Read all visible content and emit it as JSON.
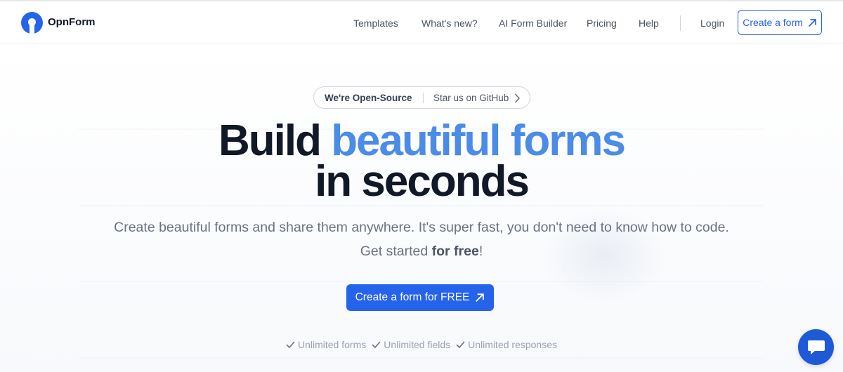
{
  "brand": {
    "name": "OpnForm",
    "logo_icon": "opnform-logo-icon",
    "color": "#2563eb"
  },
  "nav": {
    "links": [
      {
        "label": "Templates"
      },
      {
        "label": "What's new?"
      },
      {
        "label": "AI Form Builder"
      },
      {
        "label": "Pricing"
      },
      {
        "label": "Help"
      },
      {
        "label": "Login"
      }
    ],
    "cta_label": "Create a form",
    "cta_icon": "arrow-up-right-icon"
  },
  "badge": {
    "left_label": "We're Open-Source",
    "right_label": "Star us on GitHub",
    "icon": "chevron-right-icon"
  },
  "hero": {
    "headline_part1": "Build ",
    "headline_accent": "beautiful forms",
    "headline_line2": "in seconds",
    "accent_color": "#4a8ce6",
    "subtext": "Create beautiful forms and share them anywhere. It's super fast, you don't need to know how to code. Get started ",
    "subtext_bold": "for free",
    "subtext_end": "!",
    "cta_label": "Create a form for FREE",
    "cta_icon": "arrow-up-right-icon"
  },
  "features": [
    {
      "label": "Unlimited forms",
      "icon": "check-icon"
    },
    {
      "label": "Unlimited fields",
      "icon": "check-icon"
    },
    {
      "label": "Unlimited responses",
      "icon": "check-icon"
    }
  ],
  "chat_widget": {
    "icon": "chat-bubble-icon",
    "color": "#1e5ad6"
  }
}
